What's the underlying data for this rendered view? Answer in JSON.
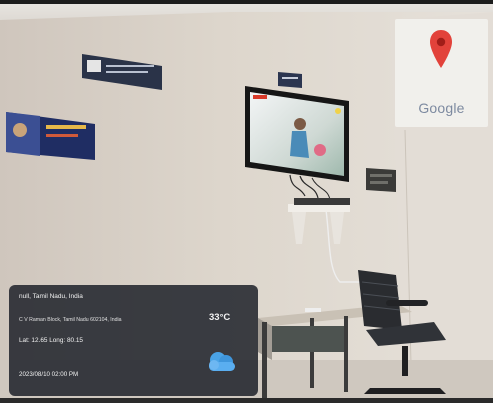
{
  "map": {
    "brand": "Google",
    "pin_color": "#e2423a"
  },
  "overlay": {
    "location": "null, Tamil Nadu, India",
    "address": "C V Raman Block, Tamil Nadu 602104, India",
    "temperature": "33°C",
    "coordinates": "Lat: 12.65  Long: 80.15",
    "datetime": "2023/08/10 02:00 PM",
    "weather_icon": "cloud-icon"
  }
}
